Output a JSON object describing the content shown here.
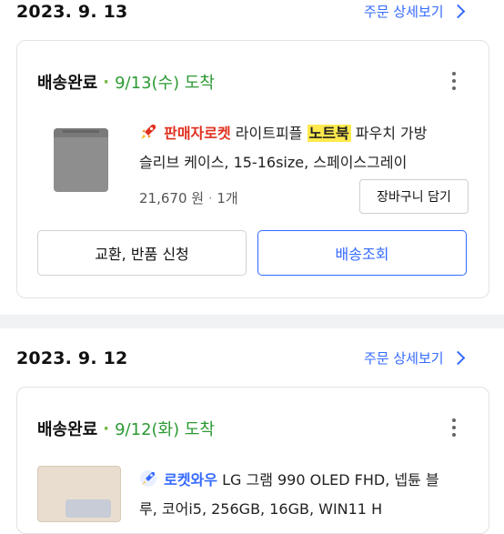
{
  "orders": [
    {
      "date": "2023. 9. 13",
      "detail_link": "주문 상세보기",
      "status": "배송완료",
      "arrival": "9/13(수) 도착",
      "badge": "판매자로켓",
      "title_before": "라이트피플",
      "title_highlight": "노트북",
      "title_after": "파우치 가방",
      "title_line2": "슬리브 케이스, 15-16size, 스페이스그레이",
      "price": "21,670 원",
      "quantity": "1개",
      "cart_button": "장바구니 담기",
      "exchange_button": "교환, 반품 신청",
      "tracking_button": "배송조회"
    },
    {
      "date": "2023. 9. 12",
      "detail_link": "주문 상세보기",
      "status": "배송완료",
      "arrival": "9/12(화) 도착",
      "badge": "로켓와우",
      "title_before": "LG 그램 990 OLED FHD, 넵튠 블",
      "title_line2": "루, 코어i5, 256GB, 16GB, WIN11 H"
    }
  ],
  "colors": {
    "accent_blue": "#346aff",
    "arrival_green": "#2c9a34",
    "seller_rocket_red": "#e0301e",
    "highlight_yellow": "#ffe94d"
  },
  "icons": [
    "rocket-icon",
    "chevron-right-icon",
    "more-vertical-icon"
  ]
}
